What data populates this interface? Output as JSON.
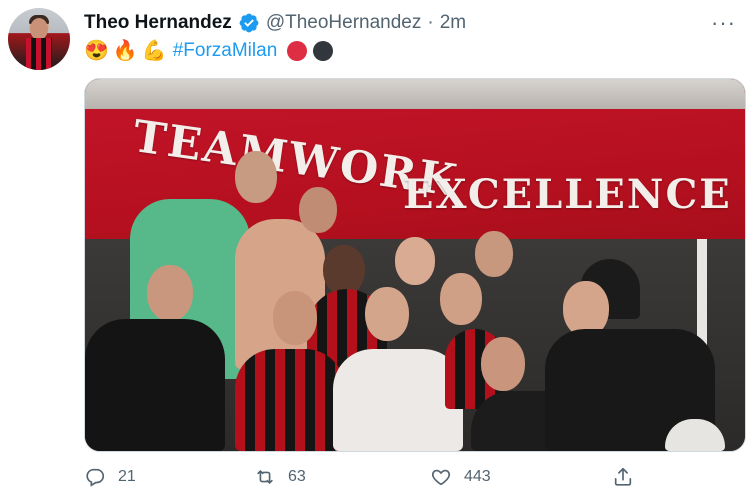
{
  "tweet": {
    "author_name": "Theo Hernandez",
    "handle": "@TheoHernandez",
    "separator": "·",
    "time": "2m",
    "emojis": [
      "😍",
      "🔥",
      "💪"
    ],
    "hashtag": "#ForzaMilan",
    "more": "···"
  },
  "media": {
    "banner_line1": "TEAMWORK",
    "banner_line2": "EXCELLENCE"
  },
  "actions": {
    "replies": "21",
    "retweets": "63",
    "likes": "443"
  },
  "colors": {
    "accent": "#1d9bf0",
    "muted": "#536471",
    "banner_red": "#c4142a"
  }
}
